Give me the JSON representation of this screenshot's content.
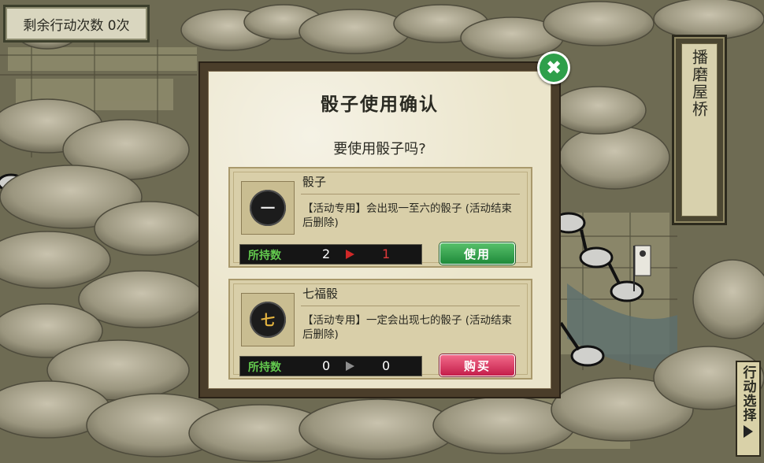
{
  "hud": {
    "actions_remaining": "剩余行动次数 0次",
    "location_name": "播磨屋桥",
    "action_select": "行动选择"
  },
  "dialog": {
    "title": "骰子使用确认",
    "question": "要使用骰子吗?",
    "items": [
      {
        "name": "骰子",
        "icon": "die-1-icon",
        "icon_glyph": "一",
        "description": "【活动专用】会出现一至六的骰子 (活动结束后删除)",
        "held_label": "所持数",
        "held_current": "2",
        "held_after": "1",
        "button": "使用"
      },
      {
        "name": "七福骰",
        "icon": "die-7-icon",
        "icon_glyph": "七",
        "description": "【活动专用】一定会出现七的骰子 (活动结束后删除)",
        "held_label": "所持数",
        "held_current": "0",
        "held_after": "0",
        "button": "购买"
      }
    ]
  },
  "colors": {
    "use_button": "#2e9f4a",
    "buy_button": "#d8345e",
    "close_button": "#2e9f4a",
    "held_label": "#63c94e"
  }
}
